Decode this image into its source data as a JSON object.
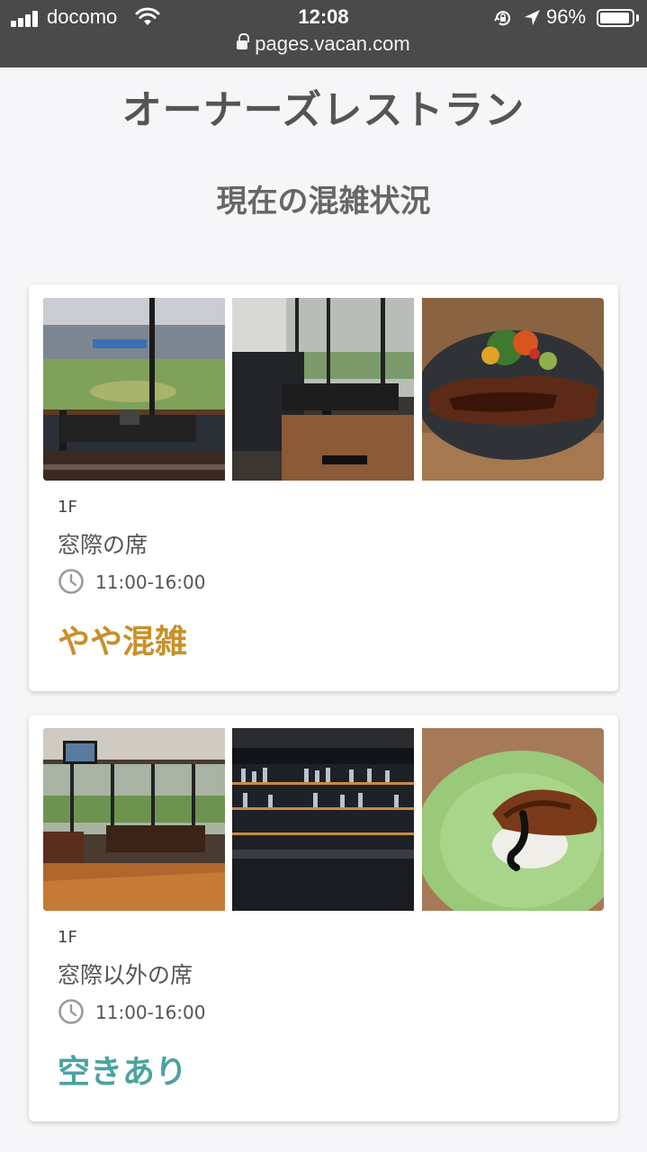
{
  "status_bar": {
    "carrier": "docomo",
    "time": "12:08",
    "battery": "96%",
    "battery_level": 0.96,
    "url": "pages.vacan.com"
  },
  "page": {
    "restaurant_name": "オーナーズレストラン",
    "section_title": "現在の混雑状況"
  },
  "cards": [
    {
      "floor": "1F",
      "seat_name": "窓際の席",
      "hours": "11:00-16:00",
      "status": "やや混雑",
      "status_color": "#c8902a",
      "photos": [
        "stadium-view-photo",
        "window-booth-photo",
        "steak-dish-photo"
      ]
    },
    {
      "floor": "1F",
      "seat_name": "窓際以外の席",
      "hours": "11:00-16:00",
      "status": "空きあり",
      "status_color": "#4aa3a0",
      "photos": [
        "dining-room-photo",
        "bar-counter-photo",
        "foie-gras-dish-photo"
      ]
    }
  ],
  "icons": {
    "clock": "clock-icon",
    "lock": "lock-icon",
    "wifi": "wifi-icon",
    "signal": "signal-icon",
    "location": "location-arrow-icon",
    "rotation_lock": "rotation-lock-icon",
    "battery": "battery-icon"
  }
}
